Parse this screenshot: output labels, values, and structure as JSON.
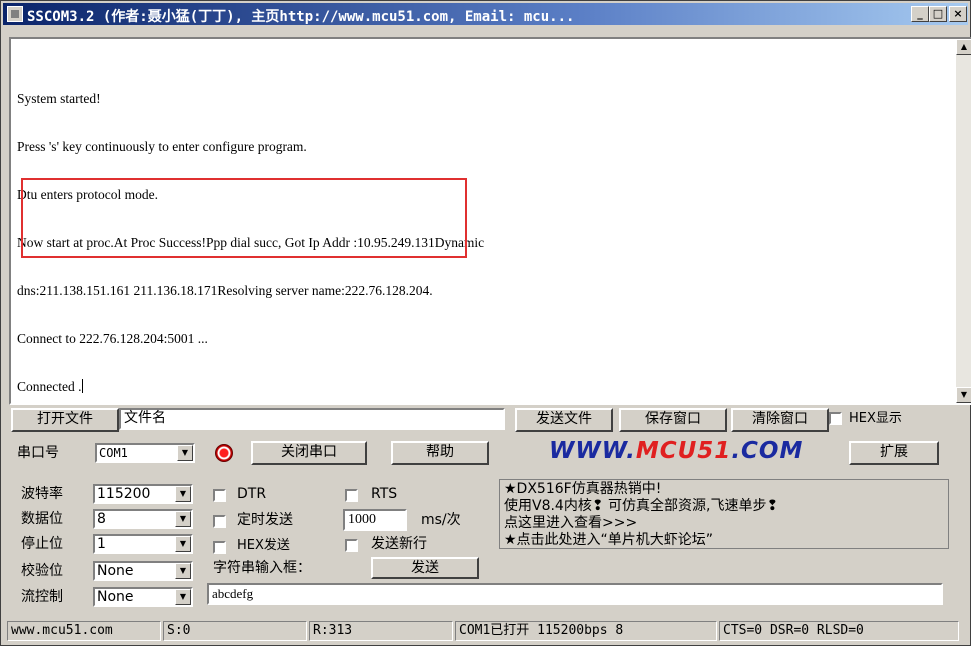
{
  "title": "SSCOM3.2 (作者:聂小猛(丁丁), 主页http://www.mcu51.com, Email: mcu...",
  "window_buttons": {
    "minimize": "_",
    "maximize": "□",
    "close": "×"
  },
  "receive_lines": [
    "System started!",
    "Press 's' key continuously to enter configure program.",
    "Dtu enters protocol mode.",
    "Now start at proc.At Proc Success!Ppp dial succ, Got Ip Addr :10.95.249.131Dynamic",
    "dns:211.138.151.161 211.136.18.171Resolving server name:222.76.128.204.",
    "Connect to 222.76.128.204:5001 ...",
    "Connected ."
  ],
  "row1": {
    "open_file": "打开文件",
    "filename": "文件名",
    "send_file": "发送文件",
    "save_window": "保存窗口",
    "clear_window": "清除窗口",
    "hex_display": "HEX显示"
  },
  "row2": {
    "port_label": "串口号",
    "port_value": "COM1",
    "close_port": "关闭串口",
    "help": "帮助",
    "website": "WWW.MCU51.COM",
    "expand": "扩展"
  },
  "settings": {
    "baud_label": "波特率",
    "baud_value": "115200",
    "databits_label": "数据位",
    "databits_value": "8",
    "stopbits_label": "停止位",
    "stopbits_value": "1",
    "parity_label": "校验位",
    "parity_value": "None",
    "flow_label": "流控制",
    "flow_value": "None"
  },
  "options": {
    "dtr": "DTR",
    "rts": "RTS",
    "timed_send": "定时发送",
    "interval_value": "1000",
    "interval_unit": "ms/次",
    "hex_send": "HEX发送",
    "send_newline": "发送新行",
    "input_label": "字符串输入框：",
    "send_button": "发送",
    "send_input": "abcdefg"
  },
  "promo": [
    "★DX516F仿真器热销中!",
    "使用V8.4内核❢ 可仿真全部资源,飞速单步❢",
    "点这里进入查看>>>",
    "★点击此处进入“单片机大虾论坛”"
  ],
  "status": {
    "site": "www.mcu51.com",
    "sent": "S:0",
    "received": "R:313",
    "port_state": "COM1已打开  115200bps  8",
    "lines": "CTS=0 DSR=0 RLSD=0"
  },
  "colors": {
    "title_start": "#0a246a",
    "highlight_box": "#e03030",
    "website_blue": "#1a2aa0",
    "website_red": "#e02020"
  }
}
